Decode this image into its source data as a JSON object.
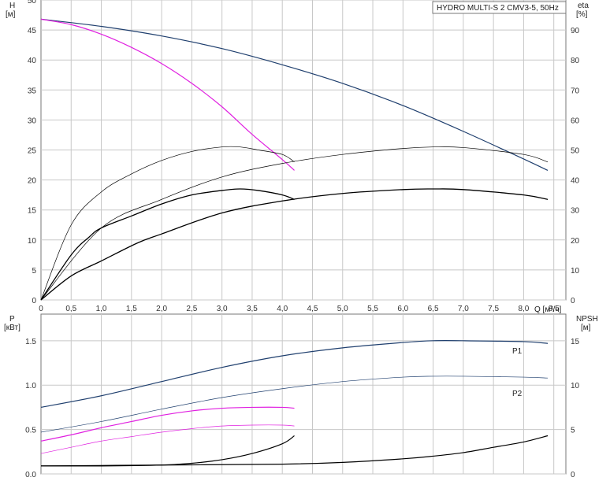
{
  "chart_data": [
    {
      "type": "line",
      "title": "HYDRO MULTI-S 2 CMV3-5, 50Hz",
      "xlabel": "Q [м³/ч]",
      "ylabel": "H",
      "ylabel_unit": "[м]",
      "y2label": "eta",
      "y2label_unit": "[%]",
      "xlim": [
        0,
        8.7
      ],
      "ylim": [
        0,
        50
      ],
      "y2lim": [
        0,
        100
      ],
      "grid": true,
      "xticks": [
        "0",
        "0,5",
        "1,0",
        "1,5",
        "2,0",
        "2,5",
        "3,0",
        "3,5",
        "4,0",
        "4,5",
        "5,0",
        "5,5",
        "6,0",
        "6,5",
        "7,0",
        "7,5",
        "8,0",
        "8,5"
      ],
      "yticks": [
        "0",
        "5",
        "10",
        "15",
        "20",
        "25",
        "30",
        "35",
        "40",
        "45",
        "50"
      ],
      "y2ticks": [
        "0",
        "10",
        "20",
        "30",
        "40",
        "50",
        "60",
        "70",
        "80",
        "90"
      ],
      "series": [
        {
          "axis": "left",
          "color": "#1f3f6e",
          "width": 1.2,
          "x": [
            0,
            1,
            2,
            3,
            4,
            5,
            6,
            7,
            8,
            8.4
          ],
          "y": [
            46.8,
            45.6,
            44,
            41.9,
            39.2,
            36.1,
            32.4,
            28.1,
            23.5,
            21.6
          ]
        },
        {
          "axis": "left",
          "color": "#e020e0",
          "width": 1.2,
          "x": [
            0,
            0.5,
            1,
            1.5,
            2,
            2.5,
            3,
            3.5,
            4,
            4.2
          ],
          "y": [
            46.8,
            45.9,
            44.3,
            42.1,
            39.4,
            36.1,
            32.2,
            27.6,
            23.4,
            21.6
          ]
        },
        {
          "axis": "right",
          "color": "#000000",
          "width": 0.7,
          "x": [
            0,
            0.5,
            1,
            1.5,
            2,
            2.5,
            3,
            3.3,
            3.6,
            4,
            4.2
          ],
          "y": [
            0,
            25,
            36,
            42,
            46.5,
            49.5,
            51,
            51,
            50,
            48.5,
            46
          ]
        },
        {
          "axis": "right",
          "color": "#000000",
          "width": 1.3,
          "x": [
            0,
            0.5,
            0.8,
            1,
            1.5,
            2,
            2.5,
            3,
            3.3,
            3.6,
            4,
            4.2
          ],
          "y": [
            0,
            15,
            21,
            24,
            28,
            32,
            35,
            36.5,
            37,
            36.5,
            35,
            33.5
          ]
        },
        {
          "axis": "right",
          "color": "#000000",
          "width": 0.7,
          "x": [
            0,
            1,
            2,
            3,
            4,
            5,
            6,
            6.5,
            7,
            8,
            8.4
          ],
          "y": [
            0,
            24,
            33.5,
            41,
            45.5,
            48.5,
            50.5,
            51,
            50.8,
            48.5,
            46
          ]
        },
        {
          "axis": "right",
          "color": "#000000",
          "width": 1.3,
          "x": [
            0,
            0.5,
            1,
            1.6,
            2,
            3,
            4,
            5,
            6,
            6.5,
            7,
            8,
            8.4
          ],
          "y": [
            0,
            8,
            13,
            19,
            22,
            29,
            33,
            35.5,
            36.8,
            37,
            36.8,
            35,
            33.5
          ]
        }
      ]
    },
    {
      "type": "line",
      "xlim": [
        0,
        8.7
      ],
      "ylabel": "P",
      "ylabel_unit": "[кВт]",
      "y2label": "NPSH",
      "y2label_unit": "[м]",
      "ylim": [
        0,
        1.8
      ],
      "y2lim": [
        0,
        18
      ],
      "grid": true,
      "yticks": [
        "0.0",
        "0.5",
        "1.0",
        "1.5"
      ],
      "y2ticks": [
        "0",
        "5",
        "10",
        "15"
      ],
      "series": [
        {
          "name": "P1",
          "axis": "left",
          "color": "#1f3f6e",
          "width": 1.2,
          "x": [
            0,
            1,
            2,
            3,
            4,
            5,
            6,
            6.5,
            7,
            8,
            8.4
          ],
          "y": [
            0.75,
            0.88,
            1.04,
            1.2,
            1.33,
            1.42,
            1.48,
            1.5,
            1.5,
            1.49,
            1.47
          ]
        },
        {
          "name": "P2",
          "axis": "left",
          "color": "#1f3f6e",
          "width": 0.7,
          "x": [
            0,
            1,
            2,
            3,
            4,
            5,
            6,
            6.5,
            7,
            8,
            8.4
          ],
          "y": [
            0.47,
            0.59,
            0.73,
            0.86,
            0.96,
            1.04,
            1.09,
            1.1,
            1.1,
            1.09,
            1.08
          ]
        },
        {
          "axis": "left",
          "color": "#e020e0",
          "width": 1.2,
          "x": [
            0,
            0.5,
            1,
            1.5,
            2,
            2.5,
            3,
            3.5,
            4,
            4.2
          ],
          "y": [
            0.37,
            0.44,
            0.52,
            0.59,
            0.66,
            0.71,
            0.74,
            0.75,
            0.75,
            0.74
          ]
        },
        {
          "axis": "left",
          "color": "#e020e0",
          "width": 0.7,
          "x": [
            0,
            0.5,
            1,
            1.5,
            2,
            2.5,
            3,
            3.5,
            4,
            4.2
          ],
          "y": [
            0.23,
            0.3,
            0.37,
            0.42,
            0.47,
            0.51,
            0.54,
            0.55,
            0.55,
            0.54
          ]
        },
        {
          "axis": "right",
          "color": "#000000",
          "width": 1.2,
          "x": [
            0,
            1,
            2,
            2.5,
            3,
            3.5,
            4,
            4.2
          ],
          "y": [
            0.9,
            0.9,
            1,
            1.2,
            1.6,
            2.3,
            3.4,
            4.3
          ]
        },
        {
          "axis": "right",
          "color": "#000000",
          "width": 1.2,
          "x": [
            0,
            2,
            4,
            5,
            6,
            6.5,
            7,
            7.5,
            8,
            8.4
          ],
          "y": [
            0.9,
            1,
            1.1,
            1.3,
            1.7,
            2.0,
            2.4,
            3.0,
            3.6,
            4.3
          ]
        }
      ],
      "labels": [
        {
          "text": "P1",
          "series": 0
        },
        {
          "text": "P2",
          "series": 1
        }
      ]
    }
  ]
}
